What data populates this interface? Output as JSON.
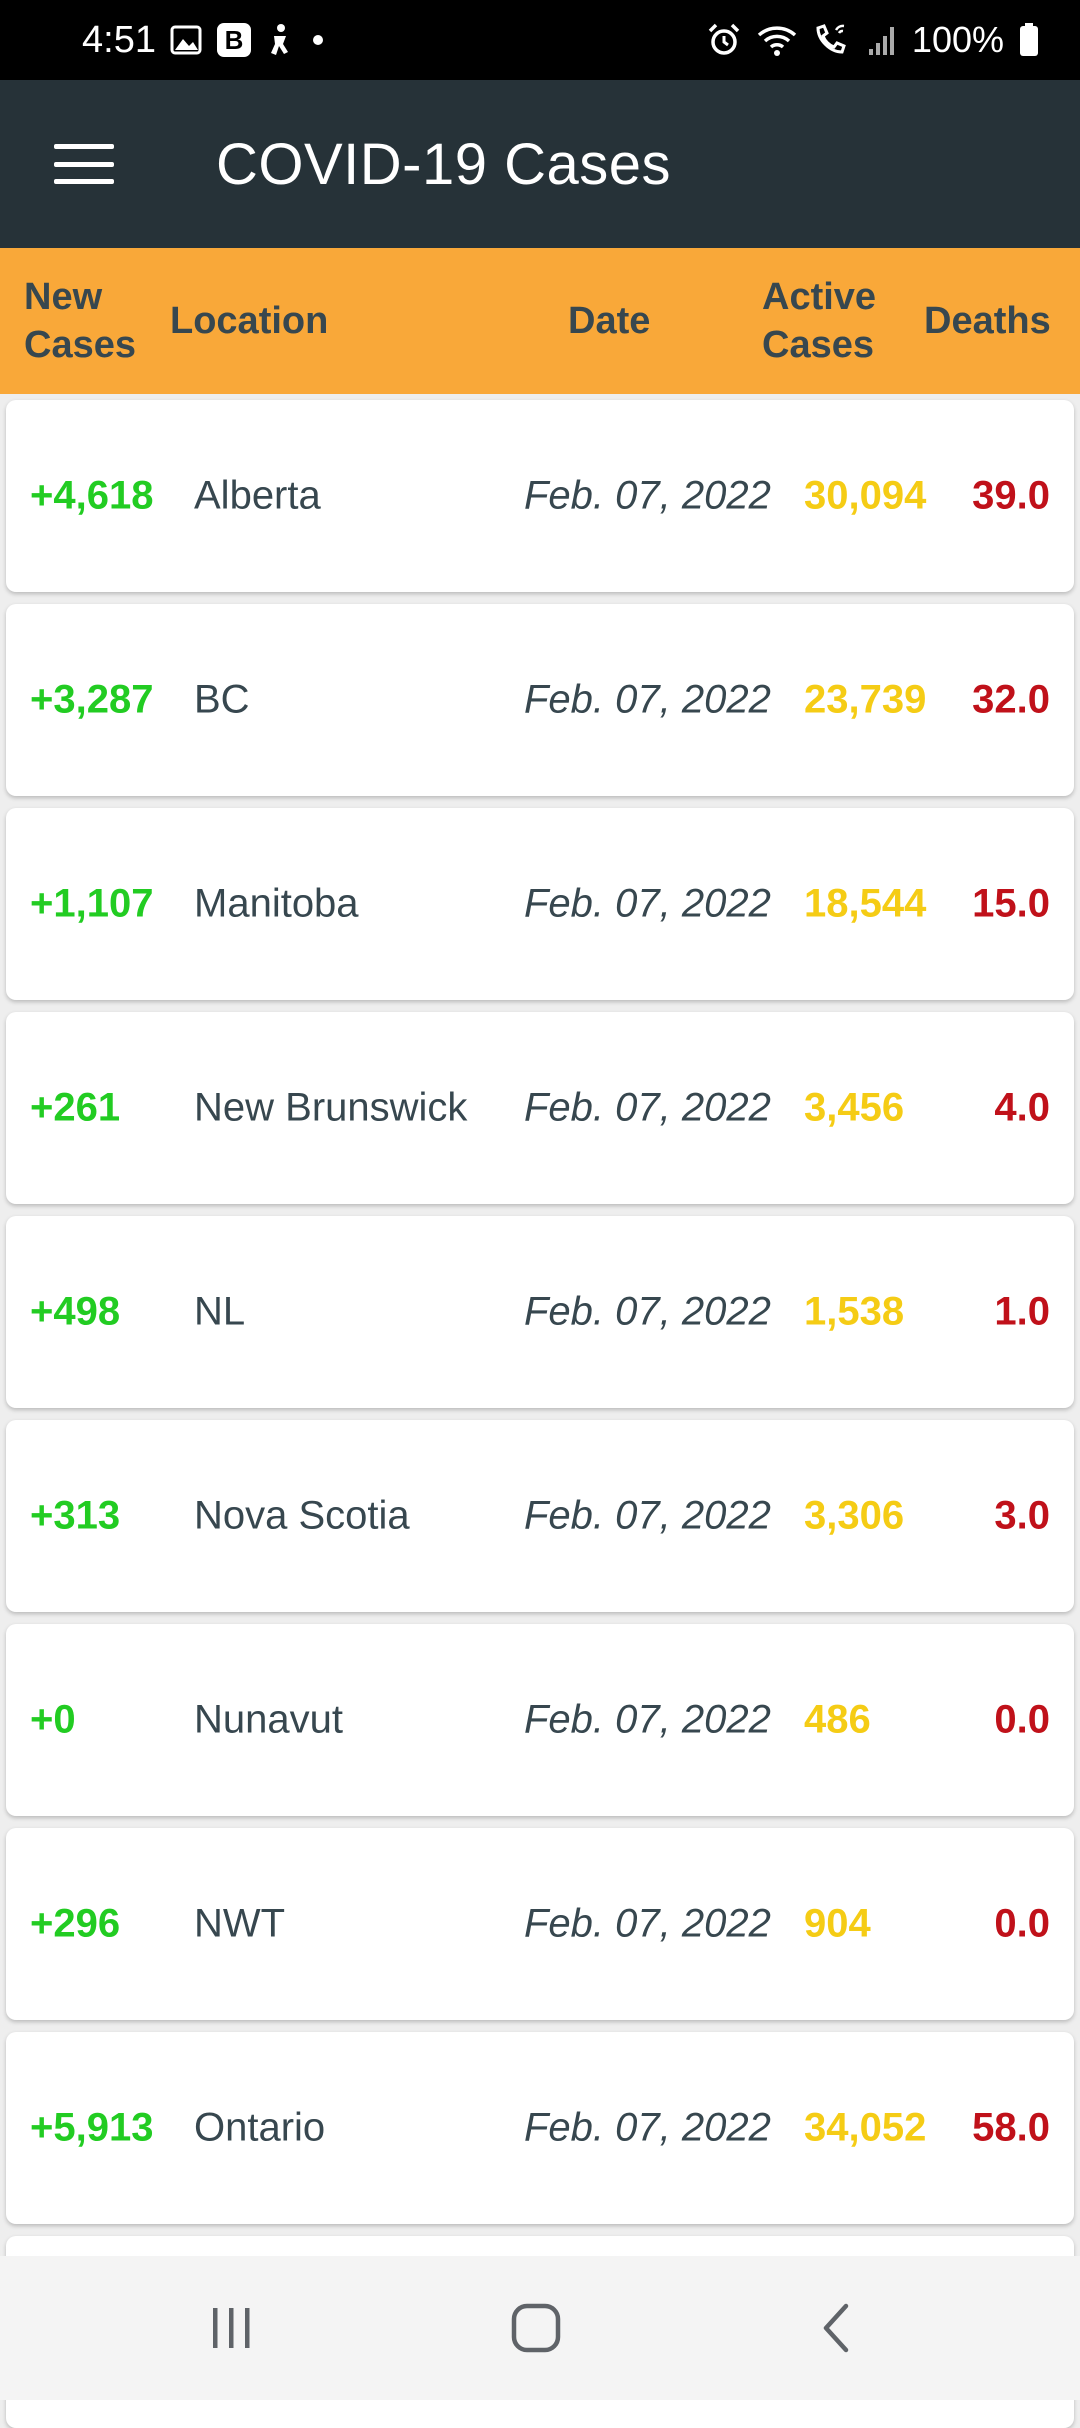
{
  "status_bar": {
    "time": "4:51",
    "battery": "100%",
    "icons": [
      "gallery-icon",
      "b-app-icon",
      "accessibility-icon",
      "dot-icon",
      "alarm-icon",
      "wifi-icon",
      "wifi-call-icon",
      "signal-icon",
      "battery-icon"
    ]
  },
  "app_bar": {
    "title": "COVID-19 Cases",
    "menu_icon": "hamburger-menu-icon"
  },
  "table": {
    "headers": {
      "new_cases": [
        "New",
        "Cases"
      ],
      "location": "Location",
      "date": "Date",
      "active_cases": [
        "Active",
        "Cases"
      ],
      "deaths": "Deaths"
    },
    "rows": [
      {
        "new_cases": "+4,618",
        "location": "Alberta",
        "date": "Feb. 07, 2022",
        "active_cases": "30,094",
        "deaths": "39.0"
      },
      {
        "new_cases": "+3,287",
        "location": "BC",
        "date": "Feb. 07, 2022",
        "active_cases": "23,739",
        "deaths": "32.0"
      },
      {
        "new_cases": "+1,107",
        "location": "Manitoba",
        "date": "Feb. 07, 2022",
        "active_cases": "18,544",
        "deaths": "15.0"
      },
      {
        "new_cases": "+261",
        "location": "New Brunswick",
        "date": "Feb. 07, 2022",
        "active_cases": "3,456",
        "deaths": "4.0"
      },
      {
        "new_cases": "+498",
        "location": "NL",
        "date": "Feb. 07, 2022",
        "active_cases": "1,538",
        "deaths": "1.0"
      },
      {
        "new_cases": "+313",
        "location": "Nova Scotia",
        "date": "Feb. 07, 2022",
        "active_cases": "3,306",
        "deaths": "3.0"
      },
      {
        "new_cases": "+0",
        "location": "Nunavut",
        "date": "Feb. 07, 2022",
        "active_cases": "486",
        "deaths": "0.0"
      },
      {
        "new_cases": "+296",
        "location": "NWT",
        "date": "Feb. 07, 2022",
        "active_cases": "904",
        "deaths": "0.0"
      },
      {
        "new_cases": "+5,913",
        "location": "Ontario",
        "date": "Feb. 07, 2022",
        "active_cases": "34,052",
        "deaths": "58.0"
      }
    ]
  },
  "nav_bar": {
    "buttons": [
      "recent-apps-icon",
      "home-icon",
      "back-icon"
    ]
  },
  "colors": {
    "app_bar": "#263238",
    "header": "#f9a839",
    "new_cases": "#22cc22",
    "active_cases": "#f5cc15",
    "deaths": "#c0111a"
  }
}
